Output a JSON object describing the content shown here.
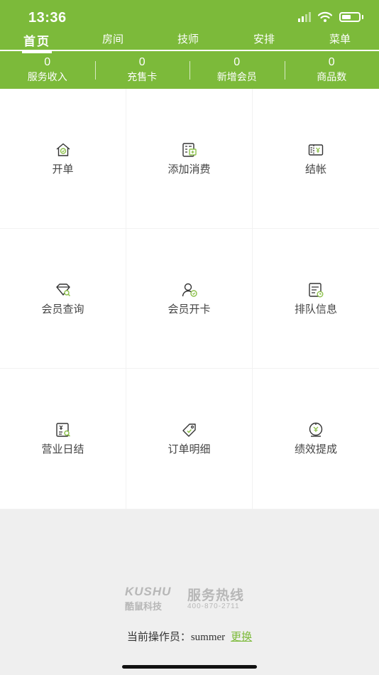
{
  "status_bar": {
    "time": "13:36"
  },
  "tabs": [
    {
      "label": "首页",
      "active": true
    },
    {
      "label": "房间"
    },
    {
      "label": "技师"
    },
    {
      "label": "安排"
    },
    {
      "label": "菜单"
    }
  ],
  "stats": [
    {
      "value": "0",
      "label": "服务收入"
    },
    {
      "value": "0",
      "label": "充售卡"
    },
    {
      "value": "0",
      "label": "新增会员"
    },
    {
      "value": "0",
      "label": "商品数"
    }
  ],
  "menu": [
    {
      "label": "开单",
      "icon": "house-icon"
    },
    {
      "label": "添加消费",
      "icon": "add-consume-icon"
    },
    {
      "label": "结帐",
      "icon": "checkout-icon"
    },
    {
      "label": "会员查询",
      "icon": "diamond-search-icon"
    },
    {
      "label": "会员开卡",
      "icon": "user-card-icon"
    },
    {
      "label": "排队信息",
      "icon": "queue-clock-icon"
    },
    {
      "label": "营业日结",
      "icon": "daily-report-icon"
    },
    {
      "label": "订单明细",
      "icon": "tag-icon"
    },
    {
      "label": "绩效提成",
      "icon": "commission-icon"
    }
  ],
  "footer": {
    "brand_en": "KUSHU",
    "brand_cn": "酷鼠科技",
    "hotline_label": "服务热线",
    "hotline_number": "400-870-2711",
    "operator_label": "当前操作员：",
    "operator_name": "summer",
    "change_label": "更换"
  },
  "colors": {
    "accent": "#7cba3a",
    "icon_green": "#8cc04a"
  }
}
